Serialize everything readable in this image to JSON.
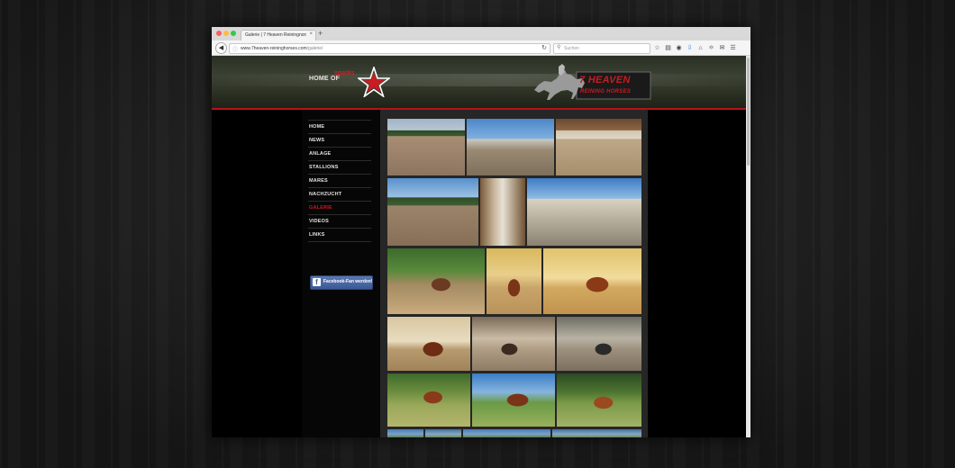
{
  "browser": {
    "tab_title": "Galerie | 7 Heaven Reiningnors…",
    "tab_close": "×",
    "new_tab": "+",
    "url_domain": "www.7heaven-reininghorses.com",
    "url_path": "/galerie/",
    "search_placeholder": "Suchen",
    "toolbar_icons": [
      "star-icon",
      "clipboard-icon",
      "pocket-icon",
      "download-icon",
      "home-icon",
      "sync-icon",
      "chat-icon",
      "menu-icon"
    ]
  },
  "header": {
    "home_of": "HOME OF",
    "sparks_text": "sparks",
    "brand_line1": "7 HEAVEN",
    "brand_line2": "REINING HORSES"
  },
  "menu": {
    "items": [
      {
        "label": "HOME"
      },
      {
        "label": "NEWS"
      },
      {
        "label": "ANLAGE"
      },
      {
        "label": "STALLIONS"
      },
      {
        "label": "MARES"
      },
      {
        "label": "NACHZUCHT"
      },
      {
        "label": "GALERIE",
        "active": true
      },
      {
        "label": "VIDEOS"
      },
      {
        "label": "LINKS"
      }
    ],
    "facebook_button": "Facebook-Fan werden!"
  },
  "colors": {
    "accent_red": "#d8161e",
    "facebook_blue": "#3b5998",
    "header_dark": "#2a2f24"
  }
}
